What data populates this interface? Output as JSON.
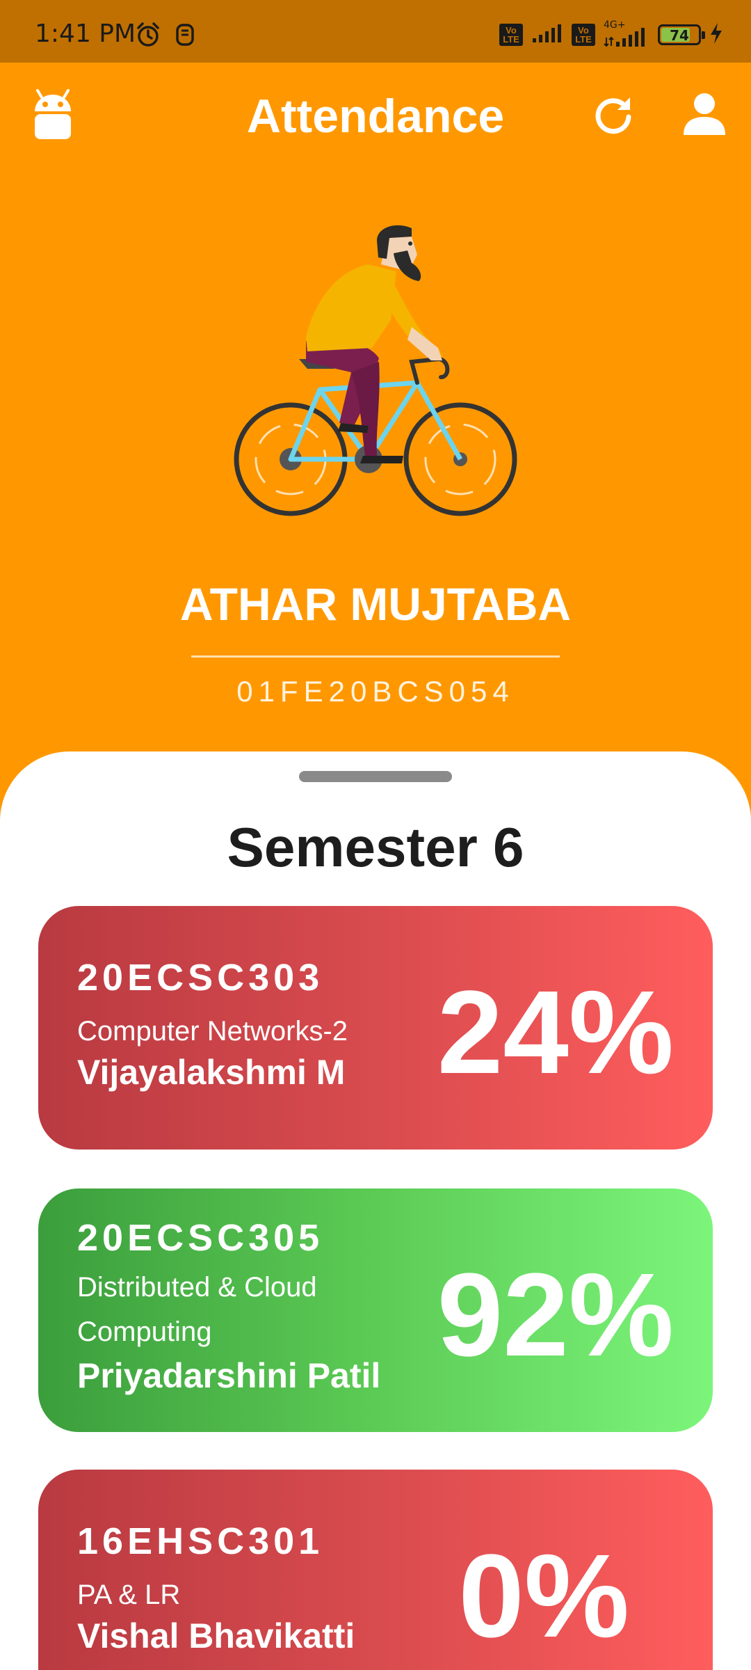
{
  "status_bar": {
    "time": "1:41 PM",
    "battery_level": "74",
    "network": "4G+",
    "sim1_badge": "Vo LTE",
    "sim2_badge": "Vo LTE",
    "icons": [
      "alarm-icon",
      "sim-card-icon",
      "signal-icon",
      "battery-icon",
      "charging-icon"
    ]
  },
  "app_bar": {
    "title": "Attendance",
    "icons": [
      "android-icon",
      "refresh-icon",
      "profile-icon"
    ]
  },
  "student": {
    "name": "ATHAR MUJTABA",
    "id": "01FE20BCS054"
  },
  "semester": {
    "title": "Semester 6"
  },
  "courses": [
    {
      "code": "20ECSC303",
      "name": "Computer Networks-2",
      "teacher": "Vijayalakshmi M",
      "attendance": "24%",
      "status": "low"
    },
    {
      "code": "20ECSC305",
      "name": "Distributed & Cloud Computing",
      "teacher": "Priyadarshini Patil",
      "attendance": "92%",
      "status": "good"
    },
    {
      "code": "16EHSC301",
      "name": "PA & LR",
      "teacher": "Vishal Bhavikatti",
      "attendance": "0%",
      "status": "low"
    }
  ],
  "colors": {
    "status_bar": "#C07000",
    "accent": "#FF9800",
    "low_attendance_start": "#B93A41",
    "low_attendance_end": "#FF5D5D",
    "good_attendance_start": "#3B9E3C",
    "good_attendance_end": "#7CF57B"
  }
}
